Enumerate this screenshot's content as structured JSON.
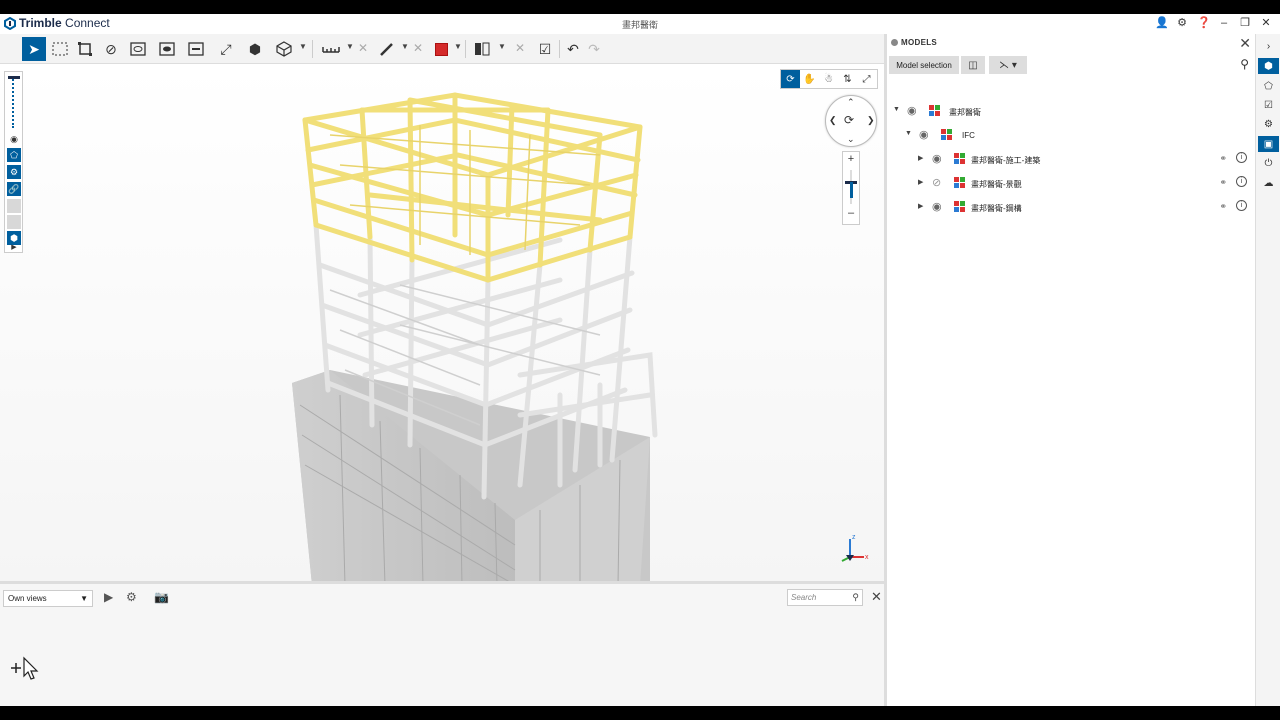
{
  "app": {
    "brand_bold": "Trimble",
    "brand_light": "Connect",
    "document_title": "畫邦醫衛"
  },
  "toolbar": {
    "tools": [
      "select-tool",
      "box-select-tool",
      "fit-selection-tool",
      "hide-tool",
      "isolate-tool",
      "section-tool",
      "section-box-tool",
      "fit-all-tool",
      "objects-tool",
      "cube-view-tool",
      "measure-tool",
      "markup-pen-tool",
      "color-tool",
      "clip-tool",
      "undo",
      "redo"
    ],
    "accent_color": "#005f9e",
    "markup_color": "#d42a2a"
  },
  "views_panel": {
    "select_value": "Own views",
    "search_placeholder": "Search"
  },
  "models_panel": {
    "title": "MODELS",
    "selection_button": "Model selection",
    "tree": [
      {
        "label": "畫邦醫衛",
        "level": 0,
        "expanded": true,
        "visible": true
      },
      {
        "label": "IFC",
        "level": 1,
        "expanded": true,
        "visible": true
      },
      {
        "label": "畫邦醫衛-施工-建築",
        "level": 2,
        "expanded": false,
        "visible": true
      },
      {
        "label": "畫邦醫衛-景觀",
        "level": 2,
        "expanded": false,
        "visible": false
      },
      {
        "label": "畫邦醫衛-鋼構",
        "level": 2,
        "expanded": false,
        "visible": true
      }
    ]
  },
  "axes": {
    "x": "x",
    "z": "z"
  }
}
